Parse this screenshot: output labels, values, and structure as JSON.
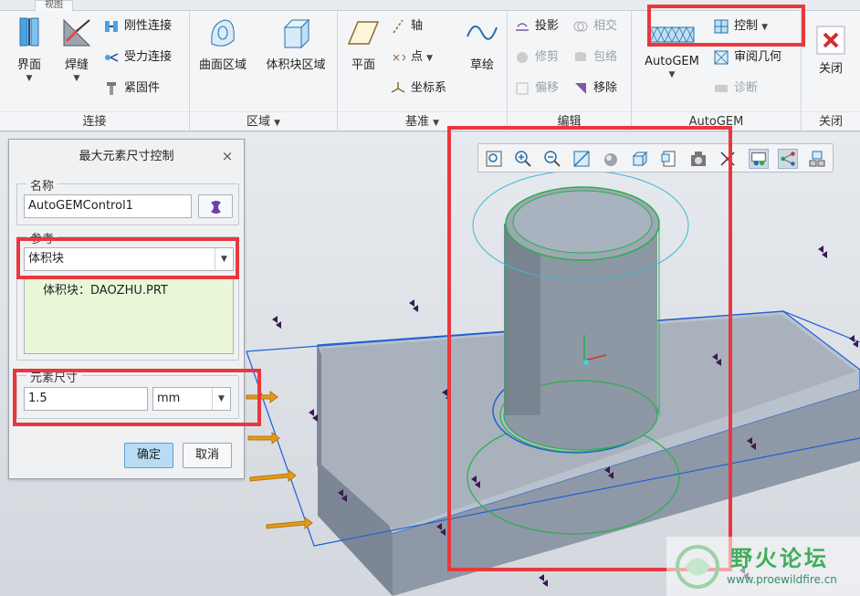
{
  "ribbon": {
    "tabs": [
      "",
      "视图"
    ],
    "groups": [
      {
        "label": "连接",
        "buttons": [
          {
            "label": "界面"
          },
          {
            "label": "焊缝"
          },
          {
            "label": "刚性连接"
          },
          {
            "label": "受力连接"
          },
          {
            "label": "紧固件"
          }
        ]
      },
      {
        "label": "区域",
        "buttons": [
          {
            "label": "曲面区域"
          },
          {
            "label": "体积块区域"
          }
        ]
      },
      {
        "label": "基准",
        "buttons": [
          {
            "label": "平面"
          },
          {
            "label": "轴"
          },
          {
            "label": "点"
          },
          {
            "label": "坐标系"
          },
          {
            "label": "草绘"
          }
        ]
      },
      {
        "label": "编辑",
        "buttons": [
          {
            "label": "投影"
          },
          {
            "label": "相交"
          },
          {
            "label": "修剪"
          },
          {
            "label": "包络"
          },
          {
            "label": "偏移"
          },
          {
            "label": "移除"
          }
        ]
      },
      {
        "label": "AutoGEM",
        "buttons": [
          {
            "label": "AutoGEM"
          },
          {
            "label": "控制"
          },
          {
            "label": "审阅几何"
          },
          {
            "label": "诊断"
          }
        ]
      },
      {
        "label": "关闭",
        "buttons": [
          {
            "label": "关闭"
          }
        ]
      }
    ]
  },
  "dialog": {
    "title": "最大元素尺寸控制",
    "name_label": "名称",
    "name_value": "AutoGEMControl1",
    "ref_label": "参考",
    "ref_type": "体积块",
    "ref_item": "体积块：DAOZHU.PRT",
    "size_label": "元素尺寸",
    "size_value": "1.5",
    "unit": "mm",
    "ok_label": "确定",
    "cancel_label": "取消"
  },
  "watermark": {
    "title": "野火论坛",
    "url": "www.proewildfire.cn"
  },
  "colors": {
    "highlight": "#e8383d",
    "model": "#8f98a6",
    "edge_blue": "#1f5fd6",
    "edge_green": "#23b24a"
  }
}
